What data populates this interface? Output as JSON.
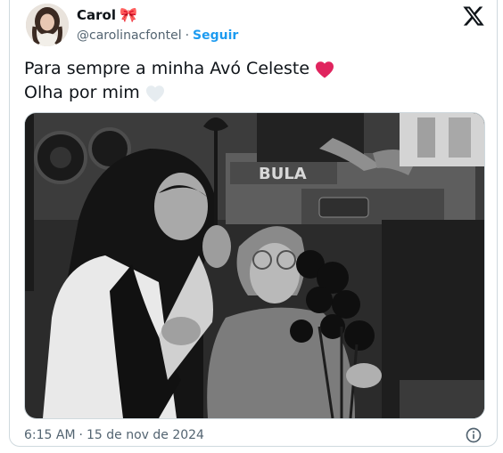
{
  "author": {
    "name": "Carol",
    "emoji": "🎀",
    "handle": "@carolinacfontel",
    "separator": "·",
    "follow_label": "Seguir"
  },
  "tweet": {
    "line1": "Para sempre a minha Avó Celeste",
    "line2": "Olha por mim",
    "heart1_color": "#e0245e",
    "heart2_color": "#e6ecf0"
  },
  "meta": {
    "time": "6:15 AM",
    "separator": "·",
    "date": "15 de nov de 2024"
  },
  "media": {
    "description_icon": "photo",
    "sign_text": "BULA"
  },
  "icons": {
    "platform": "x-logo-icon",
    "info": "info-icon"
  },
  "colors": {
    "link": "#1d9bf0",
    "muted": "#536471",
    "text": "#0f1419",
    "border": "#cfd9de"
  }
}
